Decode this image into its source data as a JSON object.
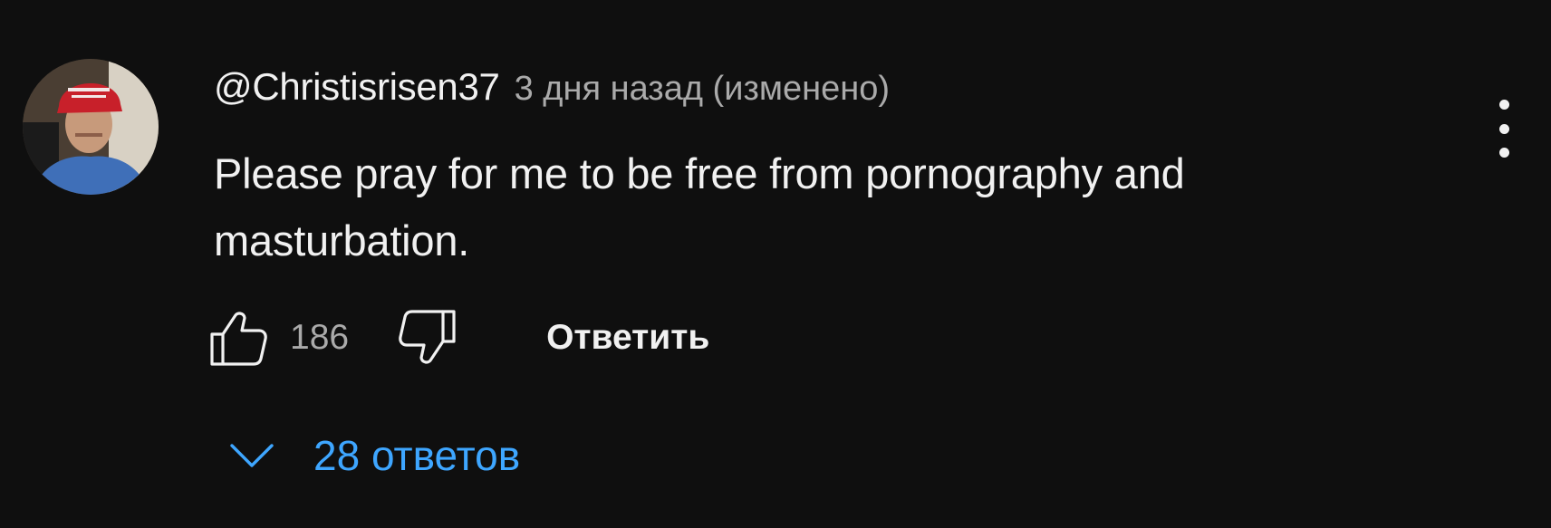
{
  "comment": {
    "author": "@Christisrisen37",
    "meta": "3 дня назад (изменено)",
    "text": "Please pray for me to be free from pornography and masturbation.",
    "like_count": "186",
    "reply_label": "Ответить",
    "replies_label": "28 ответов",
    "icons": {
      "like": "thumbs-up-icon",
      "dislike": "thumbs-down-icon",
      "more": "more-vertical-icon",
      "expand": "chevron-down-icon"
    }
  },
  "colors": {
    "background": "#0f0f0f",
    "text_primary": "#f1f1f1",
    "text_secondary": "#aaaaaa",
    "link": "#3ea6ff"
  }
}
